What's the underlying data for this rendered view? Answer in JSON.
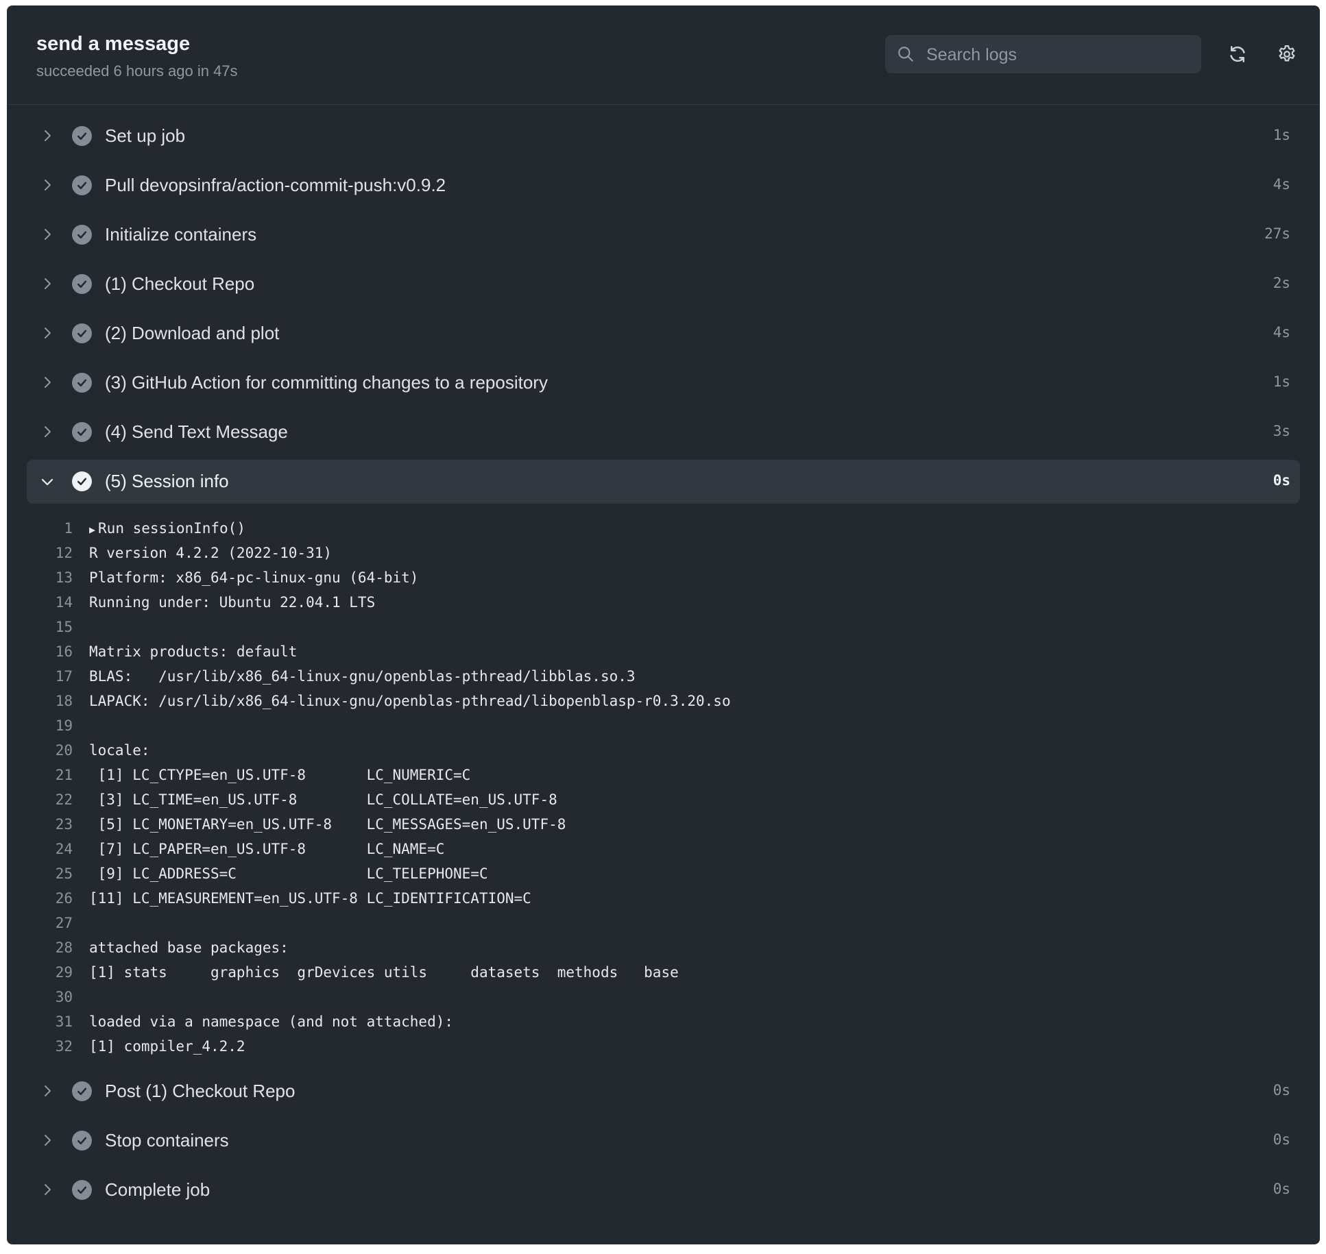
{
  "header": {
    "title": "send a message",
    "subtitle": "succeeded 6 hours ago in 47s",
    "search_placeholder": "Search logs",
    "icons": {
      "search": "search-icon",
      "refresh": "refresh-icon",
      "settings": "gear-icon"
    }
  },
  "steps_before": [
    {
      "name": "Set up job",
      "duration": "1s"
    },
    {
      "name": "Pull devopsinfra/action-commit-push:v0.9.2",
      "duration": "4s"
    },
    {
      "name": "Initialize containers",
      "duration": "27s"
    },
    {
      "name": "(1) Checkout Repo",
      "duration": "2s"
    },
    {
      "name": "(2) Download and plot",
      "duration": "4s"
    },
    {
      "name": "(3) GitHub Action for committing changes to a repository",
      "duration": "1s"
    },
    {
      "name": "(4) Send Text Message",
      "duration": "3s"
    }
  ],
  "expanded_step": {
    "name": "(5) Session info",
    "duration": "0s",
    "log": [
      {
        "n": "1",
        "text": "Run sessionInfo()",
        "collapsible": true
      },
      {
        "n": "12",
        "text": "R version 4.2.2 (2022-10-31)"
      },
      {
        "n": "13",
        "text": "Platform: x86_64-pc-linux-gnu (64-bit)"
      },
      {
        "n": "14",
        "text": "Running under: Ubuntu 22.04.1 LTS"
      },
      {
        "n": "15",
        "text": ""
      },
      {
        "n": "16",
        "text": "Matrix products: default"
      },
      {
        "n": "17",
        "text": "BLAS:   /usr/lib/x86_64-linux-gnu/openblas-pthread/libblas.so.3"
      },
      {
        "n": "18",
        "text": "LAPACK: /usr/lib/x86_64-linux-gnu/openblas-pthread/libopenblasp-r0.3.20.so"
      },
      {
        "n": "19",
        "text": ""
      },
      {
        "n": "20",
        "text": "locale:"
      },
      {
        "n": "21",
        "text": " [1] LC_CTYPE=en_US.UTF-8       LC_NUMERIC=C"
      },
      {
        "n": "22",
        "text": " [3] LC_TIME=en_US.UTF-8        LC_COLLATE=en_US.UTF-8"
      },
      {
        "n": "23",
        "text": " [5] LC_MONETARY=en_US.UTF-8    LC_MESSAGES=en_US.UTF-8"
      },
      {
        "n": "24",
        "text": " [7] LC_PAPER=en_US.UTF-8       LC_NAME=C"
      },
      {
        "n": "25",
        "text": " [9] LC_ADDRESS=C               LC_TELEPHONE=C"
      },
      {
        "n": "26",
        "text": "[11] LC_MEASUREMENT=en_US.UTF-8 LC_IDENTIFICATION=C"
      },
      {
        "n": "27",
        "text": ""
      },
      {
        "n": "28",
        "text": "attached base packages:"
      },
      {
        "n": "29",
        "text": "[1] stats     graphics  grDevices utils     datasets  methods   base"
      },
      {
        "n": "30",
        "text": ""
      },
      {
        "n": "31",
        "text": "loaded via a namespace (and not attached):"
      },
      {
        "n": "32",
        "text": "[1] compiler_4.2.2"
      }
    ]
  },
  "steps_after": [
    {
      "name": "Post (1) Checkout Repo",
      "duration": "0s"
    },
    {
      "name": "Stop containers",
      "duration": "0s"
    },
    {
      "name": "Complete job",
      "duration": "0s"
    }
  ]
}
